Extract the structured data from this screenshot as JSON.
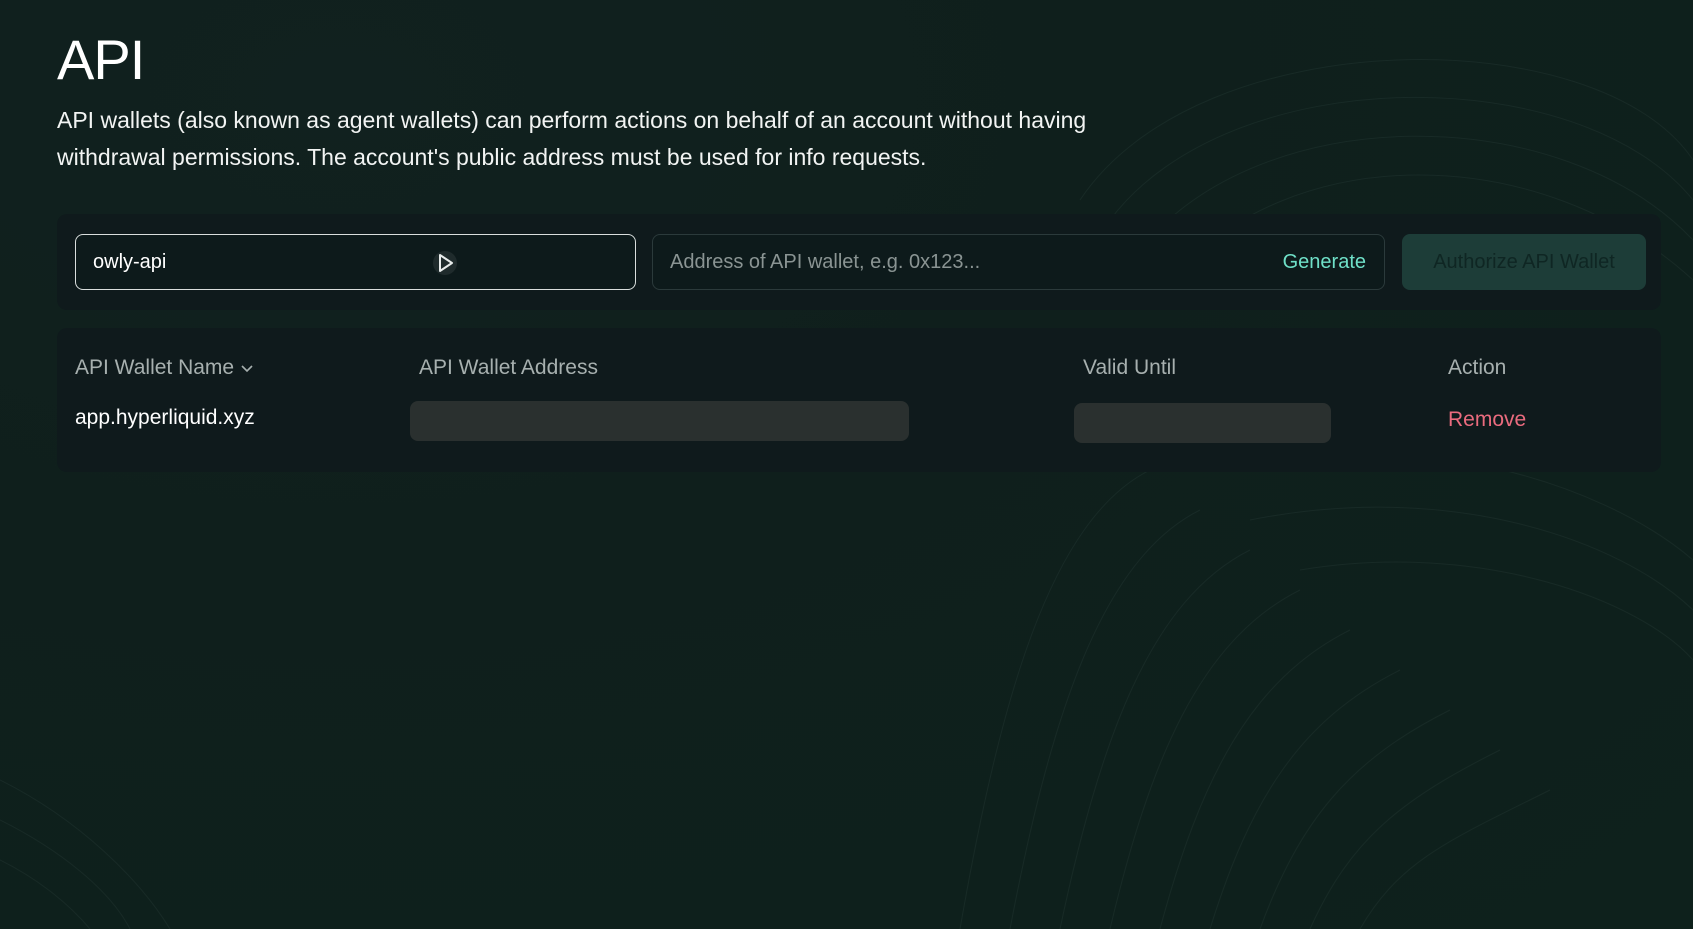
{
  "page": {
    "title": "API",
    "description": "API wallets (also known as agent wallets) can perform actions on behalf of an account without having withdrawal permissions. The account's public address must be used for info requests."
  },
  "toolbar": {
    "name_value": "owly-api",
    "address_placeholder": "Address of API wallet, e.g. 0x123...",
    "generate_label": "Generate",
    "authorize_label": "Authorize API Wallet"
  },
  "table": {
    "columns": [
      "API Wallet Name",
      "API Wallet Address",
      "Valid Until",
      "Action"
    ],
    "rows": [
      {
        "name": "app.hyperliquid.xyz",
        "action": "Remove"
      }
    ]
  },
  "colors": {
    "background": "#0f1f1c",
    "accent": "#6fe0c8",
    "danger": "#ea6b7e",
    "button_bg": "#1d3d38"
  }
}
